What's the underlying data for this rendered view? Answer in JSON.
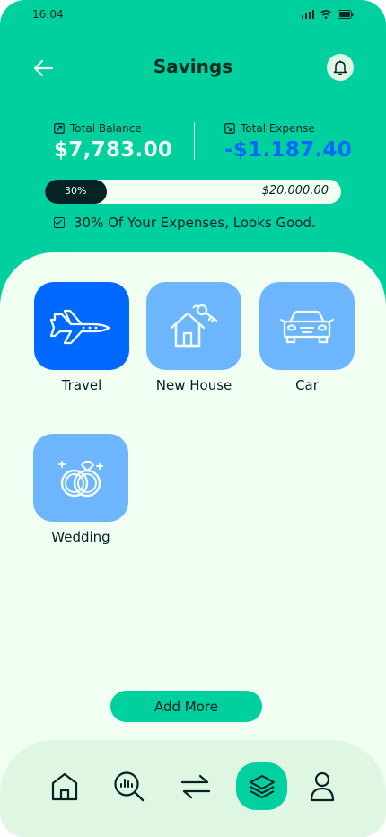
{
  "status_bar": {
    "time": "16:04"
  },
  "header": {
    "title": "Savings"
  },
  "summary": {
    "balance_label": "Total Balance",
    "balance_value": "$7,783.00",
    "expense_label": "Total Expense",
    "expense_value": "-$1.187.40"
  },
  "progress": {
    "percent_label": "30%",
    "fraction": 0.3,
    "goal_value": "$20,000.00"
  },
  "note": "30% Of Your Expenses, Looks Good.",
  "categories": [
    {
      "label": "Travel",
      "icon": "airplane-icon",
      "active": true
    },
    {
      "label": "New House",
      "icon": "house-key-icon",
      "active": false
    },
    {
      "label": "Car",
      "icon": "car-icon",
      "active": false
    },
    {
      "label": "Wedding",
      "icon": "rings-icon",
      "active": false
    }
  ],
  "add_more_label": "Add More",
  "nav": {
    "items": [
      "home-icon",
      "analysis-icon",
      "transactions-icon",
      "categories-icon",
      "profile-icon"
    ],
    "active_index": 3
  },
  "colors": {
    "brand_green": "#00D09E",
    "active_blue": "#0068FF",
    "tile_blue": "#6DB6FE",
    "sheet_bg": "#F1FFF3",
    "dark": "#052224"
  }
}
